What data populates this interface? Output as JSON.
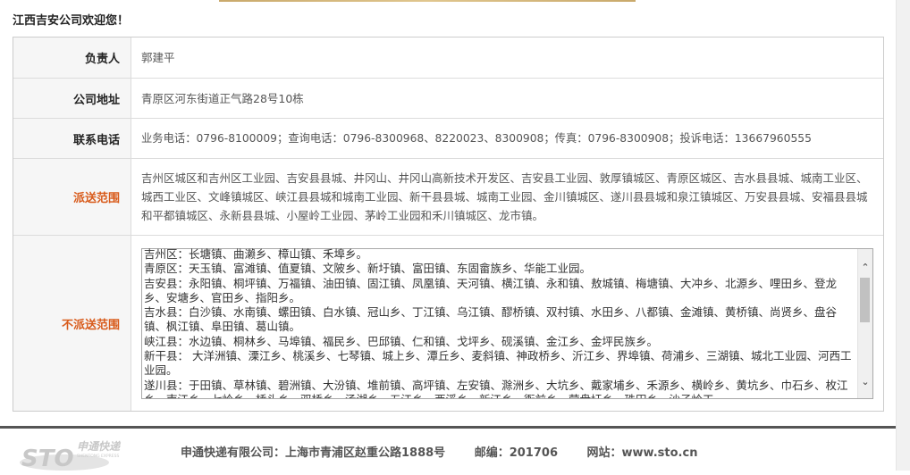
{
  "welcome": "江西吉安公司欢迎您！",
  "rows": {
    "person": {
      "label": "负责人",
      "value": "郭建平"
    },
    "address": {
      "label": "公司地址",
      "value": "青原区河东街道正气路28号10栋"
    },
    "phone": {
      "label": "联系电话",
      "value": "业务电话：0796-8100009；查询电话：0796-8300968、8220023、8300908；传真：0796-8300908；投诉电话：13667960555"
    },
    "delivery": {
      "label": "派送范围",
      "value": "吉州区城区和吉州区工业园、吉安县县城、井冈山、井冈山高新技术开发区、吉安县工业园、敦厚镇城区、青原区城区、吉水县县城、城南工业区、城西工业区、文峰镇城区、峡江县县城和城南工业园、新干县县城、城南工业园、金川镇城区、遂川县县城和泉江镇城区、万安县县城、安福县县城和平都镇城区、永新县县城、小屋岭工业园、茅岭工业园和禾川镇城区、龙市镇。"
    },
    "no_delivery": {
      "label": "不派送范围",
      "value": "吉州区：长塘镇、曲濑乡、樟山镇、禾埠乡。\n青原区：天玉镇、富滩镇、值夏镇、文陂乡、新圩镇、富田镇、东固畲族乡、华能工业园。\n吉安县：永阳镇、桐坪镇、万福镇、油田镇、固江镇、凤凰镇、天河镇、横江镇、永和镇、敖城镇、梅塘镇、大冲乡、北源乡、哩田乡、登龙乡、安塘乡、官田乡、指阳乡。\n吉水县：白沙镇、水南镇、螺田镇、白水镇、冠山乡、丁江镇、乌江镇、醪桥镇、双村镇、水田乡、八都镇、金滩镇、黄桥镇、尚贤乡、盘谷镇、枫江镇、阜田镇、葛山镇。\n峡江县：水边镇、桐林乡、马埠镇、福民乡、巴邱镇、仁和镇、戈坪乡、砚溪镇、金江乡、金坪民族乡。\n新干县： 大洋洲镇、溧江乡、桃溪乡、七琴镇、城上乡、潭丘乡、麦斜镇、神政桥乡、沂江乡、界埠镇、荷浦乡、三湖镇、城北工业园、河西工业园。\n遂川县：于田镇、草林镇、碧洲镇、大汾镇、堆前镇、高坪镇、左安镇、滁洲乡、大坑乡、戴家埔乡、禾源乡、横岭乡、黄坑乡、巾石乡、枚江乡、南江乡、七岭乡、桥头乡、双桥乡、汤湖乡、五江乡、西溪乡、新江乡、衙前乡、营盘圩乡、珠田乡、沙子岭工"
    }
  },
  "footer": {
    "logo_text": "STO",
    "logo_cn": "申通快递",
    "logo_en": "SHENTONG EXPRESS",
    "company": "申通快递有限公司：上海市青浦区赵重公路1888号",
    "postcode": "邮编：201706",
    "website": "网站：www.sto.cn"
  },
  "colors": {
    "orange_label": "#d85a1a",
    "label_bg": "#f6f6f6",
    "footer_rule": "#555555"
  },
  "icons": {
    "scroll_up": "scroll-up-arrow-icon",
    "scroll_down": "scroll-down-arrow-icon"
  }
}
